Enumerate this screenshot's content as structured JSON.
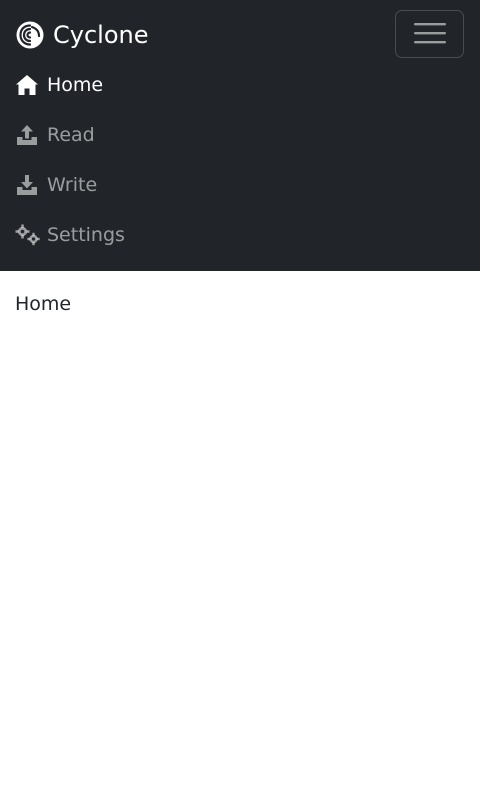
{
  "brand": {
    "name": "Cyclone",
    "icon": "cyclone-logo-icon"
  },
  "toggler": {
    "icon": "hamburger-icon"
  },
  "nav": {
    "items": [
      {
        "label": "Home",
        "icon": "house-icon",
        "active": true
      },
      {
        "label": "Read",
        "icon": "upload-icon",
        "active": false
      },
      {
        "label": "Write",
        "icon": "download-icon",
        "active": false
      },
      {
        "label": "Settings",
        "icon": "gears-icon",
        "active": false
      }
    ]
  },
  "main": {
    "heading": "Home"
  },
  "colors": {
    "navbar_bg": "#212529",
    "active_text": "#ffffff",
    "inactive_text": "#8f9296",
    "body_text": "#212529"
  }
}
